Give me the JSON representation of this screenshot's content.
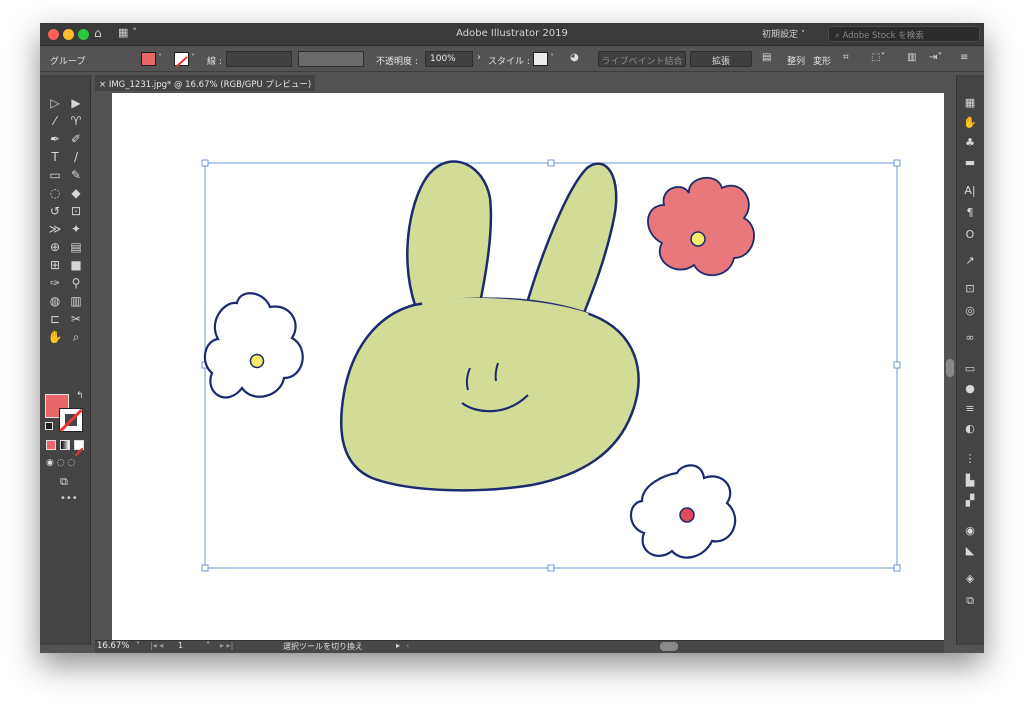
{
  "window": {
    "title": "Adobe Illustrator 2019",
    "workspace": "初期設定",
    "stock_search_placeholder": "Adobe Stock を検索"
  },
  "control_bar": {
    "selection_type": "グループ",
    "fill_color": "#e8676a",
    "stroke_label": "線 :",
    "opacity_label": "不透明度 :",
    "opacity_value": "100%",
    "style_label": "スタイル :",
    "live_paint": "ライブペイント結合",
    "expand": "拡張",
    "arrange": "整列",
    "transform": "変形"
  },
  "document_tab": {
    "label": "IMG_1231.jpg* @ 16.67% (RGB/GPU プレビュー)",
    "close": "×"
  },
  "tools": [
    "selection-tool",
    "direct-selection-tool",
    "magic-wand-tool",
    "lasso-tool",
    "pen-tool",
    "curvature-tool",
    "type-tool",
    "line-tool",
    "rectangle-tool",
    "paintbrush-tool",
    "shaper-tool",
    "eraser-tool",
    "rotate-tool",
    "scale-tool",
    "width-tool",
    "puppet-warp-tool",
    "shape-builder-tool",
    "perspective-grid-tool",
    "mesh-tool",
    "gradient-tool",
    "eyedropper-tool",
    "blend-tool",
    "symbol-sprayer-tool",
    "column-graph-tool",
    "artboard-tool",
    "slice-tool",
    "hand-tool",
    "zoom-tool"
  ],
  "artwork": {
    "colors": {
      "rabbit": "#d3dc96",
      "outline": "#1c2a6e",
      "red_flower": "#e8787c",
      "center_yellow": "#f4ec6a",
      "center_red": "#e34a5a",
      "selection": "#4a7fd8"
    },
    "content": "rabbit-face-and-three-flowers-drawing"
  },
  "status_bar": {
    "zoom": "16.67%",
    "artboard": "1",
    "tool_hint": "選択ツールを切り換え"
  },
  "right_dock_icons": [
    "libraries-icon",
    "properties-icon",
    "symbols-icon",
    "layers-doc-icon",
    "character-icon",
    "paragraph-icon",
    "opentype-icon",
    "export-icon",
    "asset-export-icon",
    "appearance-icon",
    "links-icon",
    "gradient-icon",
    "color-icon",
    "stroke-icon",
    "transparency-icon",
    "align-icon",
    "align-objects-icon",
    "pathfinder-icon",
    "recolor-icon",
    "brush-icon",
    "layers-icon",
    "artboards-icon"
  ]
}
